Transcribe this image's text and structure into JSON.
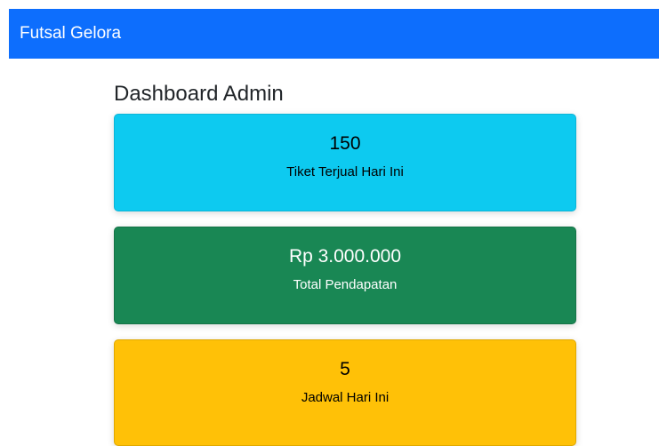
{
  "navbar": {
    "brand": "Futsal Gelora"
  },
  "page": {
    "title": "Dashboard Admin"
  },
  "cards": [
    {
      "value": "150",
      "label": "Tiket Terjual Hari Ini",
      "color": "#0dcaf0"
    },
    {
      "value": "Rp 3.000.000",
      "label": "Total Pendapatan",
      "color": "#198754"
    },
    {
      "value": "5",
      "label": "Jadwal Hari Ini",
      "color": "#ffc107"
    }
  ],
  "colors": {
    "navbar": "#0d6efd"
  }
}
